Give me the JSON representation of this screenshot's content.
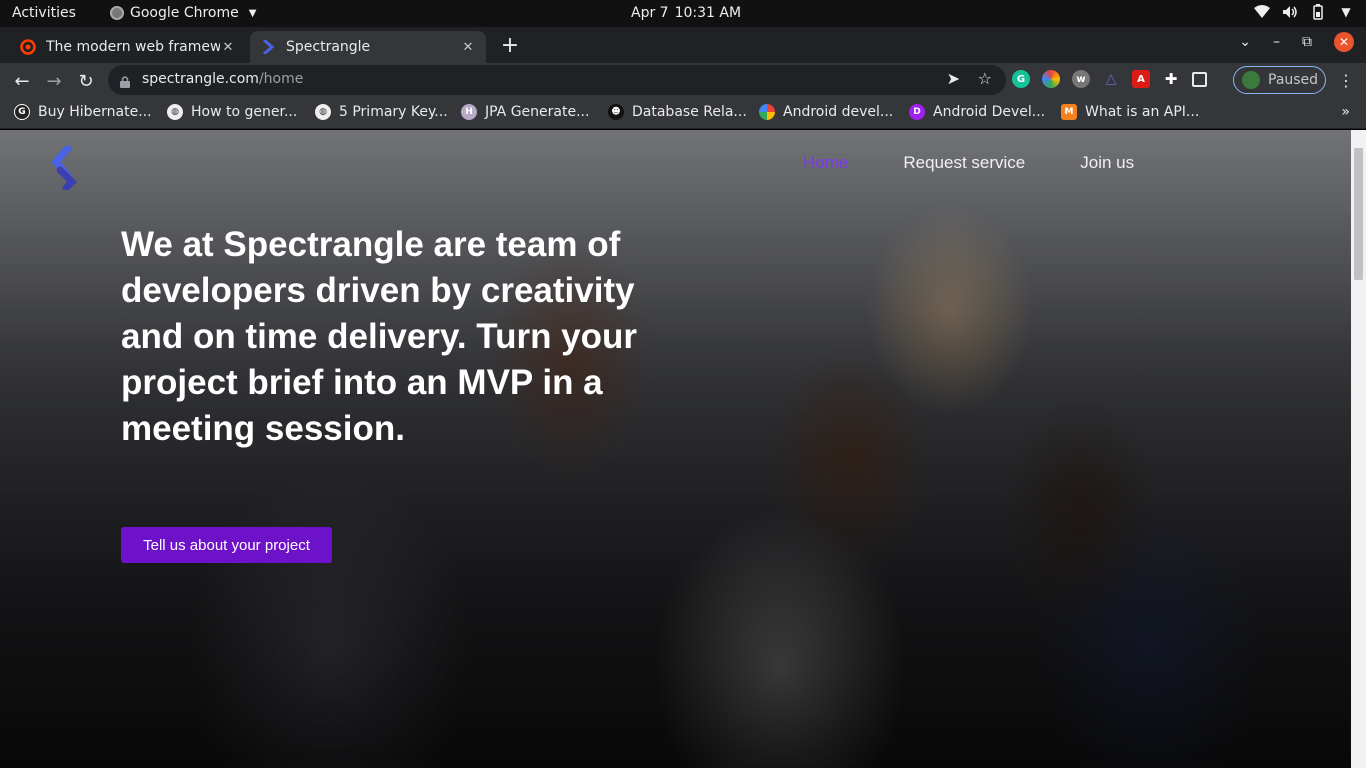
{
  "os": {
    "activities": "Activities",
    "app_name": "Google Chrome",
    "date": "Apr 7",
    "time": "10:31 AM"
  },
  "tabs": [
    {
      "title": "The modern web framewo",
      "favicon": "svelte-icon"
    },
    {
      "title": "Spectrangle",
      "favicon": "spectrangle-icon"
    }
  ],
  "address": {
    "domain": "spectrangle.com",
    "path": "/home"
  },
  "profile": {
    "label": "Paused"
  },
  "bookmarks": [
    {
      "label": "Buy Hibernate...",
      "favicon": "G"
    },
    {
      "label": "How to gener...",
      "favicon": "globe"
    },
    {
      "label": "5 Primary Key...",
      "favicon": "globe"
    },
    {
      "label": "JPA Generate...",
      "favicon": "hibernate"
    },
    {
      "label": "Database Rela...",
      "favicon": "ninja"
    },
    {
      "label": "Android devel...",
      "favicon": "google"
    },
    {
      "label": "Android Devel...",
      "favicon": "D"
    },
    {
      "label": "What is an API...",
      "favicon": "mulesoft"
    }
  ],
  "site": {
    "nav": [
      "Home",
      "Request service",
      "Join us"
    ],
    "headline": "We at Spectrangle are team of developers driven by creativity and on time delivery. Turn your project brief into an MVP in a meeting session.",
    "cta": "Tell us about your project",
    "accent_color": "#6d12c9",
    "nav_active_color": "#7c3aed"
  }
}
